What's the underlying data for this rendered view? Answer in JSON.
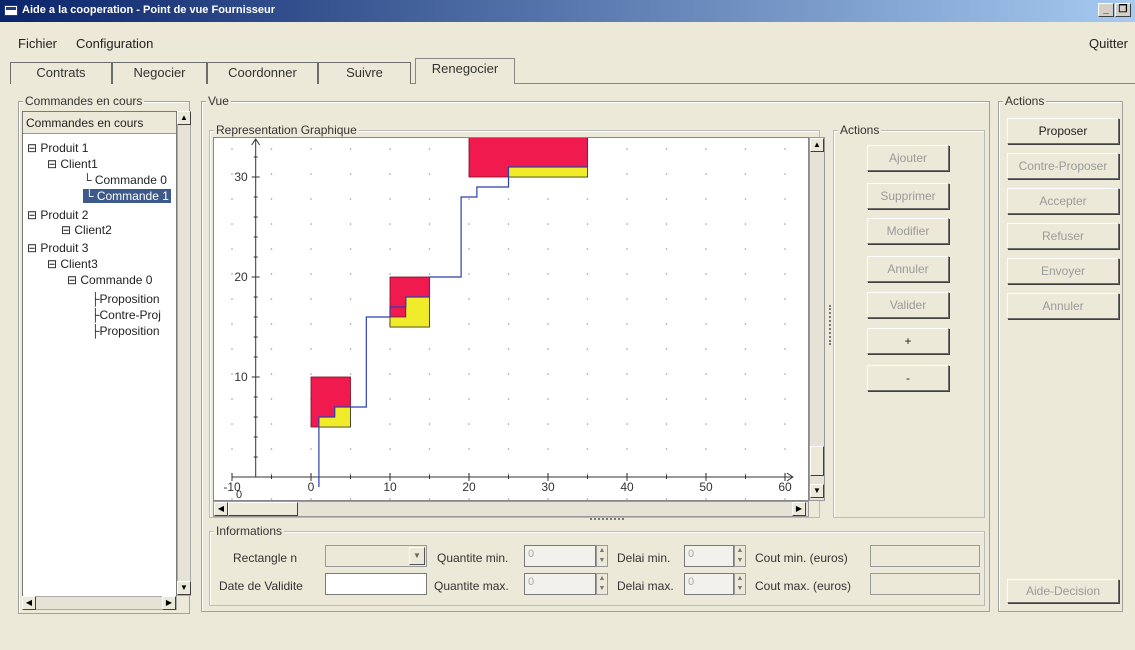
{
  "window": {
    "title": "Aide a la cooperation - Point de vue Fournisseur",
    "controls": [
      "_",
      "❐",
      "✕"
    ]
  },
  "menu": {
    "file": "Fichier",
    "config": "Configuration",
    "quit": "Quitter"
  },
  "tabs": [
    {
      "label": "Contrats",
      "active": false
    },
    {
      "label": "Negocier",
      "active": false
    },
    {
      "label": "Coordonner",
      "active": false
    },
    {
      "label": "Suivre",
      "active": false
    },
    {
      "label": "Renegocier",
      "active": true
    }
  ],
  "left": {
    "group_title": "Commandes en cours",
    "list_header": "Commandes en cours",
    "tree": [
      {
        "label": "Produit 1",
        "level": 0,
        "selected": false
      },
      {
        "label": "Client1",
        "level": 1,
        "selected": false
      },
      {
        "label": "Commande 0",
        "level": 2,
        "selected": false
      },
      {
        "label": "Commande 1",
        "level": 2,
        "selected": true
      },
      {
        "label": "Produit 2",
        "level": 0,
        "selected": false
      },
      {
        "label": "Client2",
        "level": 1,
        "selected": false
      },
      {
        "label": "Produit 3",
        "level": 0,
        "selected": false
      },
      {
        "label": "Client3",
        "level": 1,
        "selected": false
      },
      {
        "label": "Commande 0",
        "level": 2,
        "selected": false
      },
      {
        "label": "Proposition",
        "level": 3,
        "selected": false
      },
      {
        "label": "Contre-Proj",
        "level": 3,
        "selected": false
      },
      {
        "label": "Proposition",
        "level": 3,
        "selected": false
      }
    ]
  },
  "vue": {
    "group_title": "Vue",
    "graph_title": "Representation Graphique",
    "actions_title": "Actions",
    "actions": [
      {
        "label": "Ajouter",
        "enabled": false
      },
      {
        "label": "Supprimer",
        "enabled": false
      },
      {
        "label": "Modifier",
        "enabled": false
      },
      {
        "label": "Annuler",
        "enabled": false
      },
      {
        "label": "Valider",
        "enabled": false
      },
      {
        "label": "+",
        "enabled": true
      },
      {
        "label": "-",
        "enabled": true
      }
    ]
  },
  "chart_data": {
    "type": "line",
    "x_ticks": [
      "-10",
      "0",
      "10",
      "20",
      "30",
      "40",
      "50",
      "60"
    ],
    "y_ticks": [
      "10",
      "20",
      "30"
    ],
    "y_axis_bottom_label": "0",
    "xlim": [
      -10,
      60
    ],
    "ylim": [
      0,
      35
    ],
    "grid": true,
    "red_rectangles": [
      {
        "x0": 0,
        "x1": 5,
        "y0": 5,
        "y1": 10
      },
      {
        "x0": 10,
        "x1": 15,
        "y0": 15,
        "y1": 20
      },
      {
        "x0": 20,
        "x1": 35,
        "y0": 30,
        "y1": 35
      }
    ],
    "yellow_stairs": [
      {
        "points": [
          [
            1,
            5
          ],
          [
            1,
            6
          ],
          [
            3,
            6
          ],
          [
            3,
            7
          ],
          [
            5,
            7
          ],
          [
            5,
            5
          ]
        ]
      },
      {
        "points": [
          [
            10,
            15
          ],
          [
            10,
            16
          ],
          [
            12,
            16
          ],
          [
            12,
            18
          ],
          [
            15,
            18
          ],
          [
            15,
            15
          ]
        ]
      },
      {
        "points": [
          [
            25,
            30
          ],
          [
            25,
            31
          ],
          [
            35,
            31
          ],
          [
            35,
            30
          ]
        ]
      }
    ],
    "line": [
      [
        1,
        -1
      ],
      [
        1,
        6
      ],
      [
        3,
        6
      ],
      [
        3,
        7
      ],
      [
        7,
        7
      ],
      [
        7,
        16
      ],
      [
        10,
        16
      ],
      [
        10,
        17
      ],
      [
        12,
        17
      ],
      [
        12,
        18
      ],
      [
        15,
        18
      ],
      [
        15,
        20
      ],
      [
        19,
        20
      ],
      [
        19,
        28
      ],
      [
        21,
        28
      ],
      [
        21,
        29
      ],
      [
        25,
        29
      ],
      [
        25,
        31
      ],
      [
        35,
        31
      ],
      [
        35,
        35
      ]
    ],
    "colors": {
      "rect": "#f01a4e",
      "stair": "#f0ec2a",
      "line": "#2b3fb0"
    }
  },
  "info": {
    "group_title": "Informations",
    "rect_label": "Rectangle n",
    "date_label": "Date de Validite",
    "qmin_label": "Quantite min.",
    "qmax_label": "Quantite max.",
    "qmin_value": "0",
    "qmax_value": "0",
    "dmin_label": "Delai min.",
    "dmax_label": "Delai max.",
    "dmin_value": "0",
    "dmax_value": "0",
    "cmin_label": "Cout min. (euros)",
    "cmax_label": "Cout max. (euros)"
  },
  "right": {
    "group_title": "Actions",
    "buttons": [
      {
        "label": "Proposer",
        "enabled": true
      },
      {
        "label": "Contre-Proposer",
        "enabled": false
      },
      {
        "label": "Accepter",
        "enabled": false
      },
      {
        "label": "Refuser",
        "enabled": false
      },
      {
        "label": "Envoyer",
        "enabled": false
      },
      {
        "label": "Annuler",
        "enabled": false
      }
    ],
    "aide_label": "Aide-Decision"
  }
}
